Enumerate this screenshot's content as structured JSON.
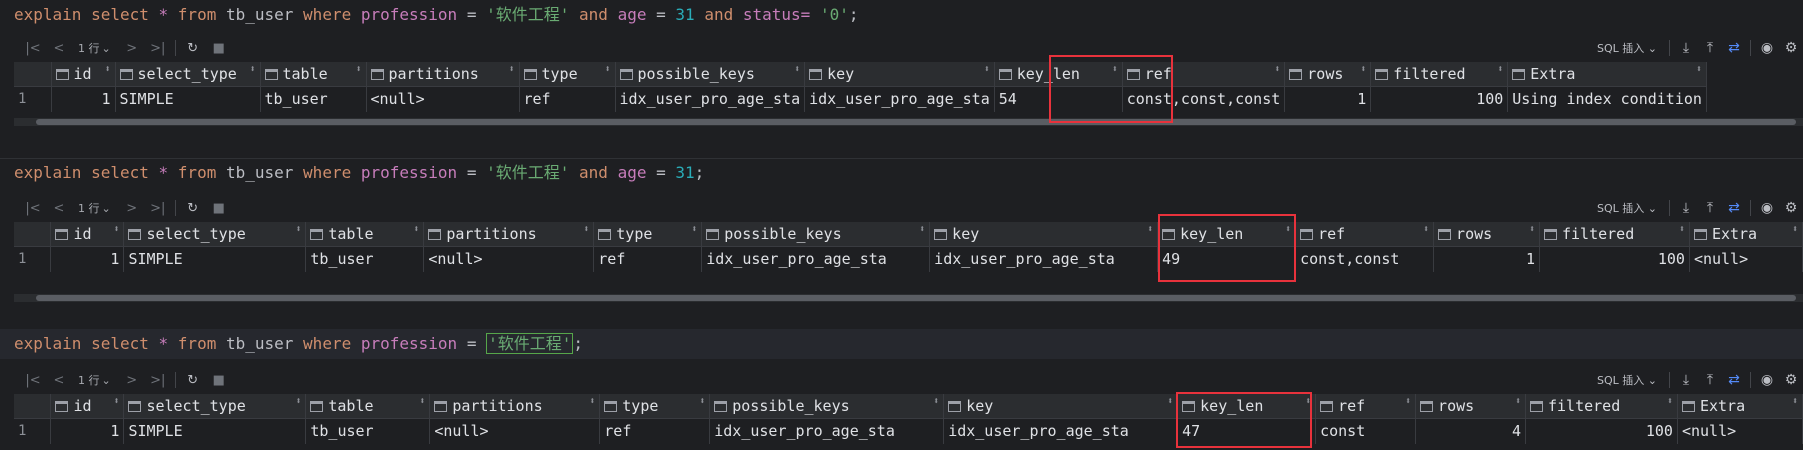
{
  "toolbar": {
    "rows_label": "1 行",
    "sql_mode_label": "SQL 插入",
    "icons": [
      "first-page-icon",
      "prev-page-icon",
      "next-page-icon",
      "last-page-icon",
      "refresh-icon",
      "stop-icon",
      "export-icon",
      "import-icon",
      "compare-icon",
      "view-icon",
      "settings-icon"
    ]
  },
  "queries": [
    {
      "kw_explain": "explain",
      "kw_select": "select",
      "star": "*",
      "kw_from": "from",
      "table": "tb_user",
      "kw_where": "where",
      "col1": "profession",
      "eq": "=",
      "val1": "'软件工程'",
      "kw_and1": "and",
      "col2": "age",
      "val2": "31",
      "kw_and2": "and",
      "col3": "status=",
      "val3": "'0'",
      "end": ";",
      "result": {
        "headers": [
          "id",
          "select_type",
          "table",
          "partitions",
          "type",
          "possible_keys",
          "key",
          "key_len",
          "ref",
          "rows",
          "filtered",
          "Extra"
        ],
        "row_index": "1",
        "row": [
          "1",
          "SIMPLE",
          "tb_user",
          "<null>",
          "ref",
          "idx_user_pro_age_sta",
          "idx_user_pro_age_sta",
          "54",
          "const,const,const",
          "1",
          "100",
          "Using index condition"
        ]
      }
    },
    {
      "kw_explain": "explain",
      "kw_select": "select",
      "star": "*",
      "kw_from": "from",
      "table": "tb_user",
      "kw_where": "where",
      "col1": "profession",
      "eq": "=",
      "val1": "'软件工程'",
      "kw_and1": "and",
      "col2": "age",
      "val2": "31",
      "end": ";",
      "result": {
        "headers": [
          "id",
          "select_type",
          "table",
          "partitions",
          "type",
          "possible_keys",
          "key",
          "key_len",
          "ref",
          "rows",
          "filtered",
          "Extra"
        ],
        "row_index": "1",
        "row": [
          "1",
          "SIMPLE",
          "tb_user",
          "<null>",
          "ref",
          "idx_user_pro_age_sta",
          "idx_user_pro_age_sta",
          "49",
          "const,const",
          "1",
          "100",
          "<null>"
        ]
      }
    },
    {
      "kw_explain": "explain",
      "kw_select": "select",
      "star": "*",
      "kw_from": "from",
      "table": "tb_user",
      "kw_where": "where",
      "col1": "profession",
      "eq": "=",
      "val1": "'软件工程'",
      "end": ";",
      "result": {
        "headers": [
          "id",
          "select_type",
          "table",
          "partitions",
          "type",
          "possible_keys",
          "key",
          "key_len",
          "ref",
          "rows",
          "filtered",
          "Extra"
        ],
        "row_index": "1",
        "row": [
          "1",
          "SIMPLE",
          "tb_user",
          "<null>",
          "ref",
          "idx_user_pro_age_sta",
          "idx_user_pro_age_sta",
          "47",
          "const",
          "4",
          "100",
          "<null>"
        ]
      }
    }
  ],
  "colors": {
    "background": "#1e1f22",
    "highlight_box": "#e8323c",
    "null_value": "#548af7",
    "keyword": "#cf8e6d",
    "string": "#6aab73",
    "number": "#2aacb8",
    "identifier": "#c77dbb"
  }
}
